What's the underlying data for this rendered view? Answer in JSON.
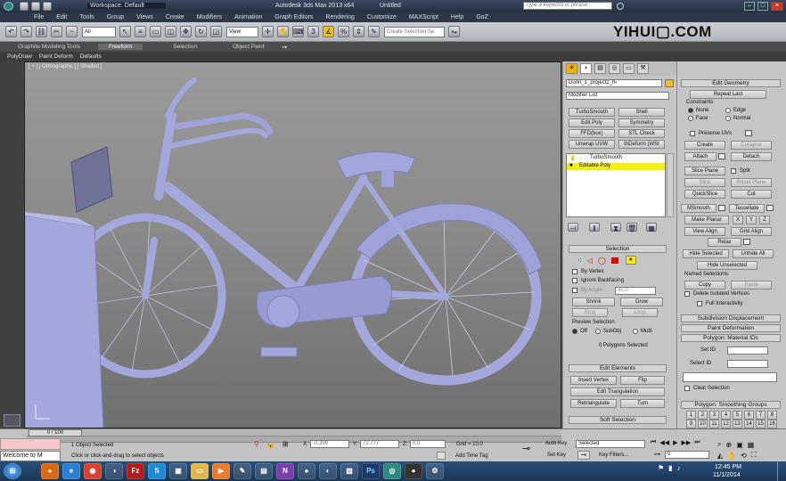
{
  "titlebar": {
    "workspace": "Workspace: Default",
    "app_title": "Autodesk 3ds Max 2013 x64",
    "doc_title": "Untitled",
    "search_placeholder": "Type a keyword or phrase"
  },
  "menubar": {
    "items": [
      "File",
      "Edit",
      "Tools",
      "Group",
      "Views",
      "Create",
      "Modifiers",
      "Animation",
      "Graph Editors",
      "Rendering",
      "Customize",
      "MAXScript",
      "Help",
      "GoZ"
    ]
  },
  "toolbar": {
    "filter_select": "All",
    "view_select": "View",
    "selection_set_placeholder": "Create Selection Se"
  },
  "watermark": "YIHUI▢.COM",
  "ribbon": {
    "tabs": [
      "Graphite Modeling Tools",
      "Freeform",
      "Selection",
      "Object Paint"
    ],
    "active_tab": "Freeform",
    "subtabs": [
      "PolyDraw",
      "Paint Deform",
      "Defaults"
    ]
  },
  "viewport": {
    "label": "[ + ] [ Orthographic ] [ Shaded ]"
  },
  "modify_panel": {
    "object_name": "Dunn_1_project2_hi",
    "modifier_list": "Modifier List",
    "buttons": [
      "TurboSmooth",
      "Shell",
      "Edit Poly",
      "Symmetry",
      "FFD(box)",
      "STL Check",
      "Unwrap UVW",
      "thDeform (WSI"
    ],
    "stack": [
      "TurboSmooth",
      "Editable Poly"
    ],
    "selection": {
      "title": "Selection",
      "by_vertex": "By Vertex",
      "ignore_backfacing": "Ignore Backfacing",
      "by_angle": "By Angle:",
      "angle_value": "45.0",
      "shrink": "Shrink",
      "grow": "Grow",
      "ring": "Ring",
      "loop": "Loop",
      "preview_selection": "Preview Selection",
      "preview_off": "Off",
      "preview_subobj": "SubObj",
      "preview_multi": "Multi",
      "status": "0 Polygons Selected"
    },
    "edit_elements": {
      "title": "Edit Elements",
      "insert_vertex": "Insert Vertex",
      "flip": "Flip",
      "edit_triangulation": "Edit Triangulation",
      "retriangulate": "Retriangulate",
      "turn": "Turn"
    },
    "soft_selection": "Soft Selection"
  },
  "edit_geometry": {
    "title": "Edit Geometry",
    "repeat_last": "Repeat Last",
    "constraints": "Constraints",
    "c_none": "None",
    "c_edge": "Edge",
    "c_face": "Face",
    "c_normal": "Normal",
    "preserve_uvs": "Preserve UVs",
    "create": "Create",
    "collapse": "Collapse",
    "attach": "Attach",
    "detach": "Detach",
    "slice_plane": "Slice Plane",
    "split": "Split",
    "slice": "Slice",
    "reset_plane": "Reset Plane",
    "quickslice": "QuickSlice",
    "cut": "Cut",
    "msmooth": "MSmooth",
    "tessellate": "Tessellate",
    "make_planar": "Make Planar",
    "x": "X",
    "y": "Y",
    "z": "Z",
    "view_align": "View Align",
    "grid_align": "Grid Align",
    "relax": "Relax",
    "hide_selected": "Hide Selected",
    "unhide_all": "Unhide All",
    "hide_unselected": "Hide Unselected",
    "named_selections": "Named Selections:",
    "copy": "Copy",
    "paste": "Paste",
    "delete_isolated": "Delete Isolated Vertices",
    "full_interactivity": "Full Interactivity",
    "subdivision_displacement": "Subdivision Displacement",
    "paint_deformation": "Paint Deformation",
    "material_ids": "Polygon: Material IDs",
    "set_id": "Set ID:",
    "select_id": "Select ID",
    "clear_selection": "Clear Selection",
    "smoothing_groups": "Polygon: Smoothing Groups",
    "sg_numbers": [
      "1",
      "2",
      "3",
      "4",
      "5",
      "6",
      "7",
      "8",
      "9",
      "10",
      "11",
      "12",
      "13",
      "14",
      "15",
      "16"
    ]
  },
  "statusbar": {
    "time_slider": "0 / 100",
    "objects_selected": "1 Object Selected",
    "prompt": "Click or click-and-drag to select objects",
    "x_label": "X:",
    "x_value": "-0.399",
    "y_label": "Y:",
    "y_value": "72.777",
    "z_label": "Z:",
    "z_value": "0.0",
    "grid": "Grid = 10.0",
    "add_time_tag": "Add Time Tag",
    "auto_key": "Auto Key",
    "set_key": "Set Key",
    "selected": "Selected",
    "key_filters": "Key Filters...",
    "frame": "0",
    "welcome": "Welcome to M"
  },
  "taskbar": {
    "time": "12:45 PM",
    "date": "11/1/2014"
  },
  "colors": {
    "bike": "#a3a7db",
    "bike_shade": "#7d82bd",
    "highlight_yellow": "#f1f109"
  }
}
